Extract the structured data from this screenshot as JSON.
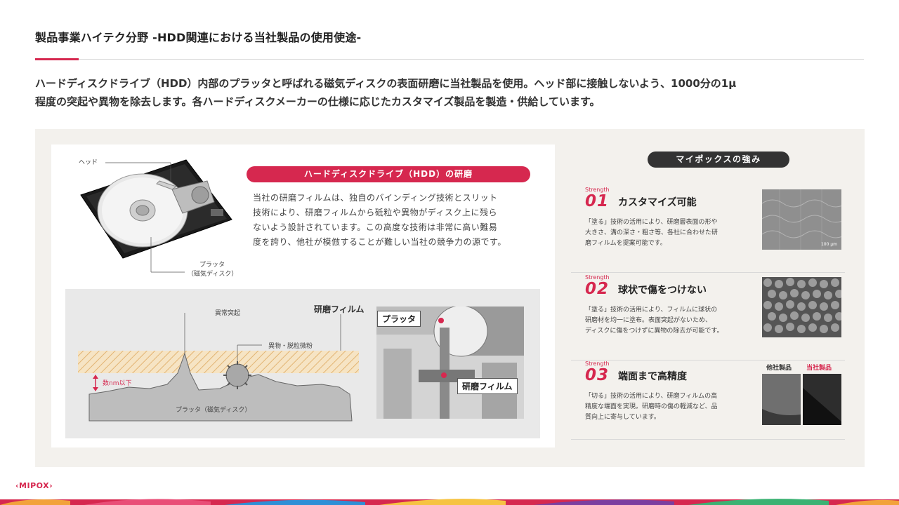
{
  "header": {
    "title": "製品事業ハイテク分野 -HDD関連における当社製品の使用使途-",
    "accent_color": "#d6284f"
  },
  "intro": {
    "line1": "ハードディスクドライブ（HDD）内部のプラッタと呼ばれる磁気ディスクの表面研磨に当社製品を使用。ヘッド部に接触しないよう、1000分の1μ",
    "line2": "程度の突起や異物を除去します。各ハードディスクメーカーの仕様に応じたカスタマイズ製品を製造・供給しています。"
  },
  "hdd_figure": {
    "head_label": "ヘッド",
    "platter_label_1": "プラッタ",
    "platter_label_2": "（磁気ディスク）"
  },
  "hdd_section": {
    "heading": "ハードディスクドライブ（HDD）の研磨",
    "desc_lines": [
      "当社の研磨フィルムは、独自のバインディング技術とスリット",
      "技術により、研磨フィルムから砥粒や異物がディスク上に残ら",
      "ないよう設計されています。この高度な技術は非常に高い難易",
      "度を誇り、他社が模倣することが難しい当社の競争力の源です。"
    ]
  },
  "cross_section": {
    "abnormal_protrusion": "異常突起",
    "film_label": "研磨フィルム",
    "foreign_matter": "異物・脱粒微粉",
    "depth_label": "数nm以下",
    "platter_label": "プラッタ（磁気ディスク）"
  },
  "photo": {
    "platter_tag": "プラッタ",
    "film_tag": "研磨フィルム"
  },
  "strengths": {
    "heading": "マイポックスの強み",
    "items": [
      {
        "tag": "Strength",
        "number": "01",
        "title": "カスタマイズ可能",
        "lines": [
          "「塗る」技術の活用により、研磨層表面の形や",
          "大きさ、溝の深さ・粗さ等、各社に合わせた研",
          "磨フィルムを提案可能です。"
        ],
        "scale_label": "100 μm"
      },
      {
        "tag": "Strength",
        "number": "02",
        "title": "球状で傷をつけない",
        "lines": [
          "「塗る」技術の活用により、フィルムに球状の",
          "研磨材を均一に塗布。表面突起がないため、",
          "ディスクに傷をつけずに異物の除去が可能です。"
        ]
      },
      {
        "tag": "Strength",
        "number": "03",
        "title": "端面まで高精度",
        "lines": [
          "「切る」技術の活用により、研磨フィルムの高",
          "精度な端面を実現。研磨時の傷の軽減など、品",
          "質向上に寄与しています。"
        ],
        "compare_other": "他社製品",
        "compare_ours": "当社製品"
      }
    ]
  },
  "footer": {
    "logo": "‹MIPOX›"
  }
}
